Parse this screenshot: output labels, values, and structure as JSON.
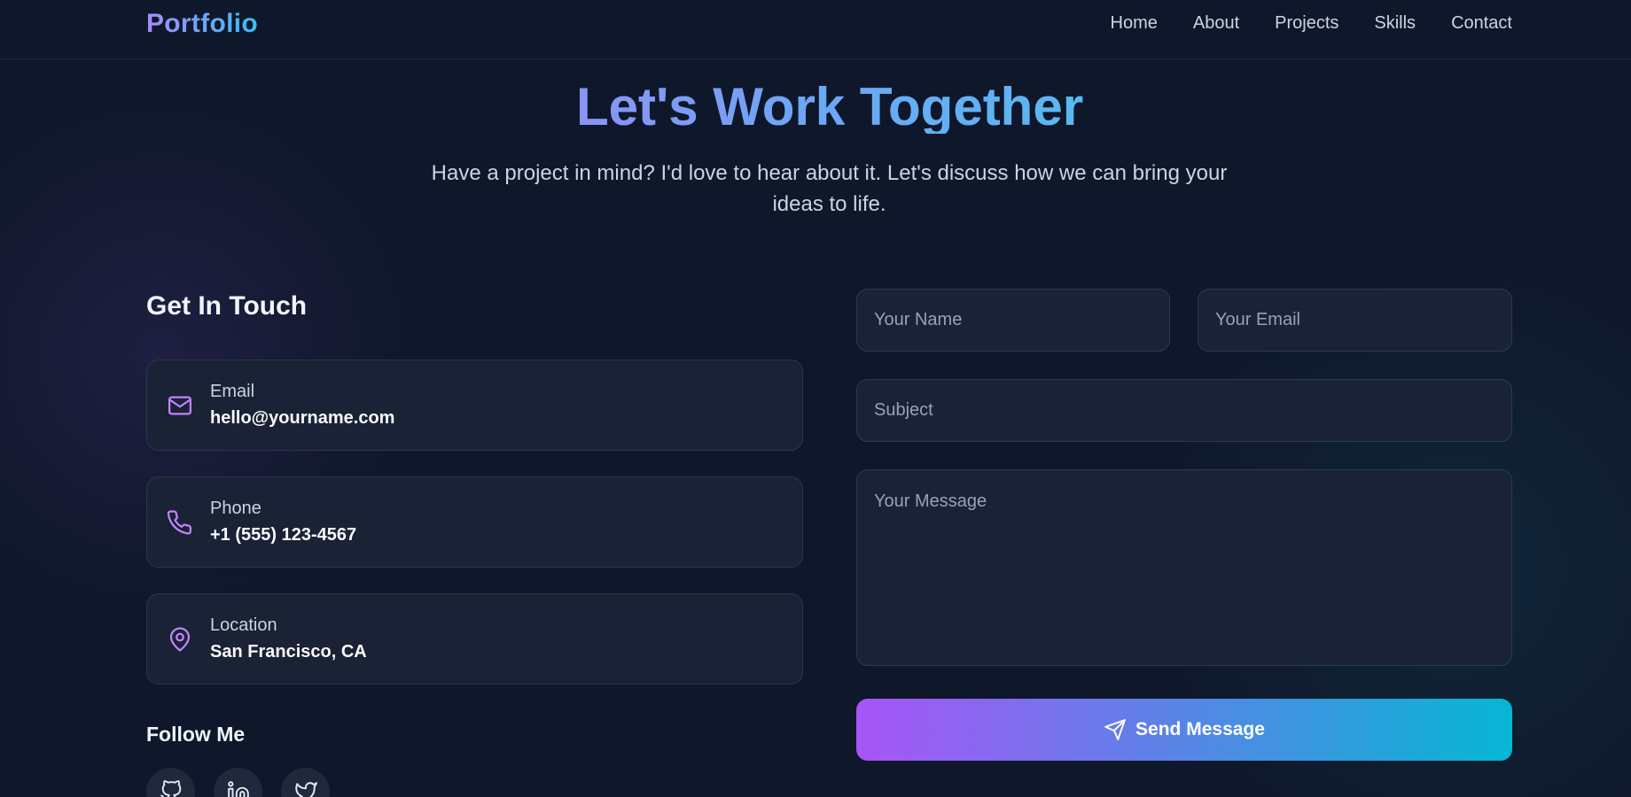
{
  "navbar": {
    "logo": "Portfolio",
    "links": [
      "Home",
      "About",
      "Projects",
      "Skills",
      "Contact"
    ]
  },
  "hero": {
    "title": "Let's Work Together",
    "subtitle": "Have a project in mind? I'd love to hear about it. Let's discuss how we can bring your ideas to life."
  },
  "contact_info": {
    "title": "Get In Touch",
    "items": [
      {
        "label": "Email",
        "value": "hello@yourname.com",
        "icon": "mail-icon"
      },
      {
        "label": "Phone",
        "value": "+1 (555) 123-4567",
        "icon": "phone-icon"
      },
      {
        "label": "Location",
        "value": "San Francisco, CA",
        "icon": "map-pin-icon"
      }
    ],
    "follow_title": "Follow Me",
    "socials": [
      "github-icon",
      "linkedin-icon",
      "twitter-icon"
    ]
  },
  "form": {
    "name_placeholder": "Your Name",
    "email_placeholder": "Your Email",
    "subject_placeholder": "Subject",
    "message_placeholder": "Your Message",
    "submit_label": "Send Message"
  },
  "colors": {
    "background": "#0f172a",
    "accent_purple": "#a855f7",
    "accent_cyan": "#06b6d4",
    "icon": "#c084fc"
  }
}
